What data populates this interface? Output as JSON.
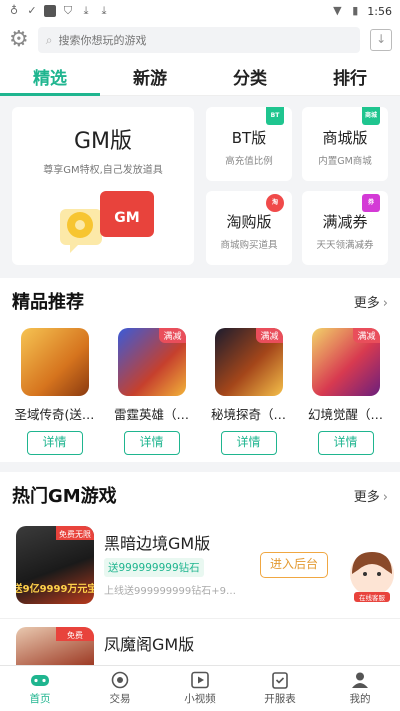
{
  "statusbar": {
    "time": "1:56"
  },
  "search": {
    "placeholder": "搜索你想玩的游戏"
  },
  "tabs": [
    {
      "label": "精选"
    },
    {
      "label": "新游"
    },
    {
      "label": "分类"
    },
    {
      "label": "排行"
    }
  ],
  "feature": {
    "gm": {
      "title": "GM版",
      "subtitle": "尊享GM特权,自己发放道具",
      "logo_text": "GM"
    },
    "cards": [
      {
        "title": "BT版",
        "subtitle": "高充值比例",
        "badge": "BT",
        "badge_color": "#1fc58f"
      },
      {
        "title": "商城版",
        "subtitle": "内置GM商城",
        "badge": "商城",
        "badge_color": "#1fc58f"
      },
      {
        "title": "淘购版",
        "subtitle": "商城购买道具",
        "badge": "淘",
        "badge_color": "#f04a4a"
      },
      {
        "title": "满减券",
        "subtitle": "天天领满减券",
        "badge": "券",
        "badge_color": "#d43ad6"
      }
    ]
  },
  "recommend": {
    "title": "精品推荐",
    "more": "更多",
    "items": [
      {
        "name": "圣域传奇(送…",
        "tag": "",
        "button": "详情"
      },
      {
        "name": "雷霆英雄（…",
        "tag": "满减",
        "button": "详情"
      },
      {
        "name": "秘境探奇（…",
        "tag": "满减",
        "button": "详情"
      },
      {
        "name": "幻境觉醒（…",
        "tag": "满减",
        "button": "详情"
      }
    ]
  },
  "hot": {
    "title": "热门GM游戏",
    "more": "更多",
    "items": [
      {
        "name": "黑暗边境GM版",
        "tag": "送999999999钻石",
        "desc": "上线送999999999钻石+9…",
        "button": "进入后台",
        "icon_text": "送9亿9999万元宝",
        "icon_top": "免费无限"
      },
      {
        "name": "凤魔阁GM版",
        "tag": "",
        "desc": "",
        "button": "",
        "icon_text": "",
        "icon_top": "免费"
      }
    ],
    "service_label": "在线客服"
  },
  "bottomnav": [
    {
      "label": "首页"
    },
    {
      "label": "交易"
    },
    {
      "label": "小视频"
    },
    {
      "label": "开服表"
    },
    {
      "label": "我的"
    }
  ],
  "colors": {
    "accent": "#1fb58f",
    "orange": "#f0a742",
    "red": "#e94e5b"
  }
}
